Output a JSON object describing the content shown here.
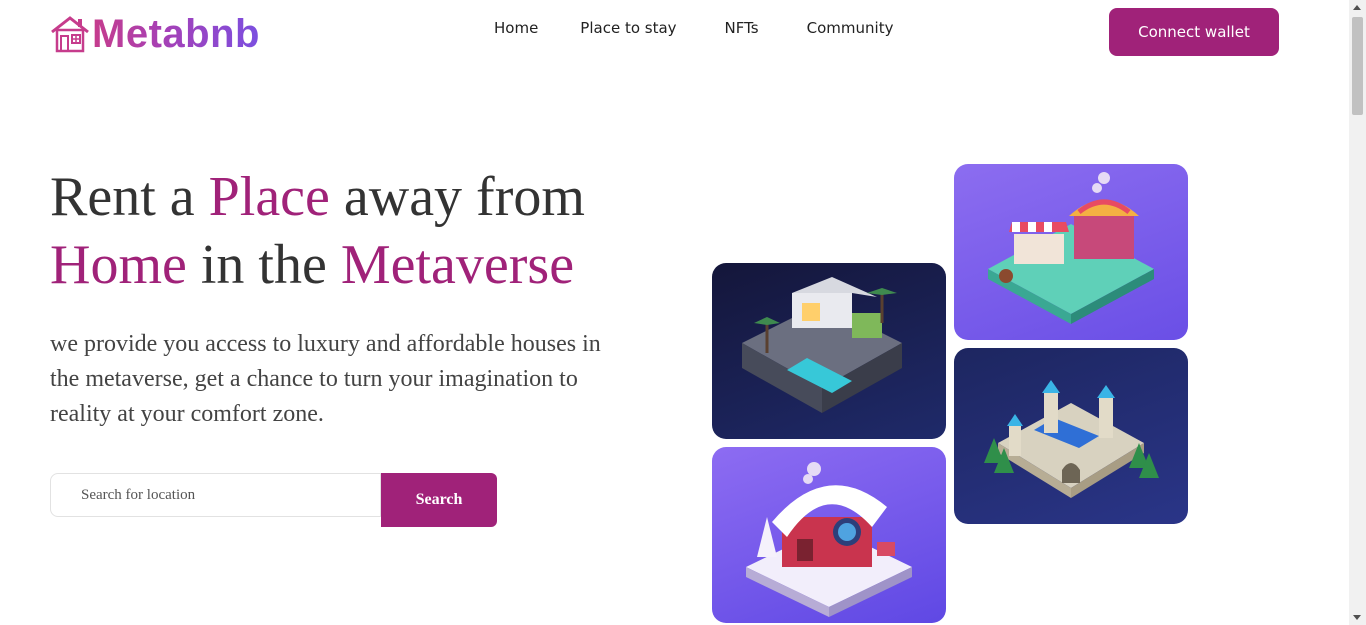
{
  "brand": {
    "name": "Metabnb",
    "logo_icon": "house-icon"
  },
  "nav": {
    "items": [
      "Home",
      "Place to stay",
      "NFTs",
      "Community"
    ]
  },
  "header": {
    "connect_label": "Connect wallet"
  },
  "hero": {
    "title_parts": [
      "Rent a ",
      "Place",
      " away from ",
      "Home",
      " in the ",
      "Metaverse"
    ],
    "description": "we provide you access to luxury and affordable houses in the metaverse, get a chance to turn your imagination to reality at your comfort zone."
  },
  "search": {
    "placeholder": "Search for location",
    "value": "",
    "button_label": "Search"
  },
  "images": [
    "market-stall-image",
    "modern-villa-image",
    "castle-image",
    "snow-cabin-image"
  ],
  "colors": {
    "accent": "#a02279",
    "text": "#333333",
    "gradient_start": "#c63c8c",
    "gradient_end": "#7b4fe0"
  }
}
